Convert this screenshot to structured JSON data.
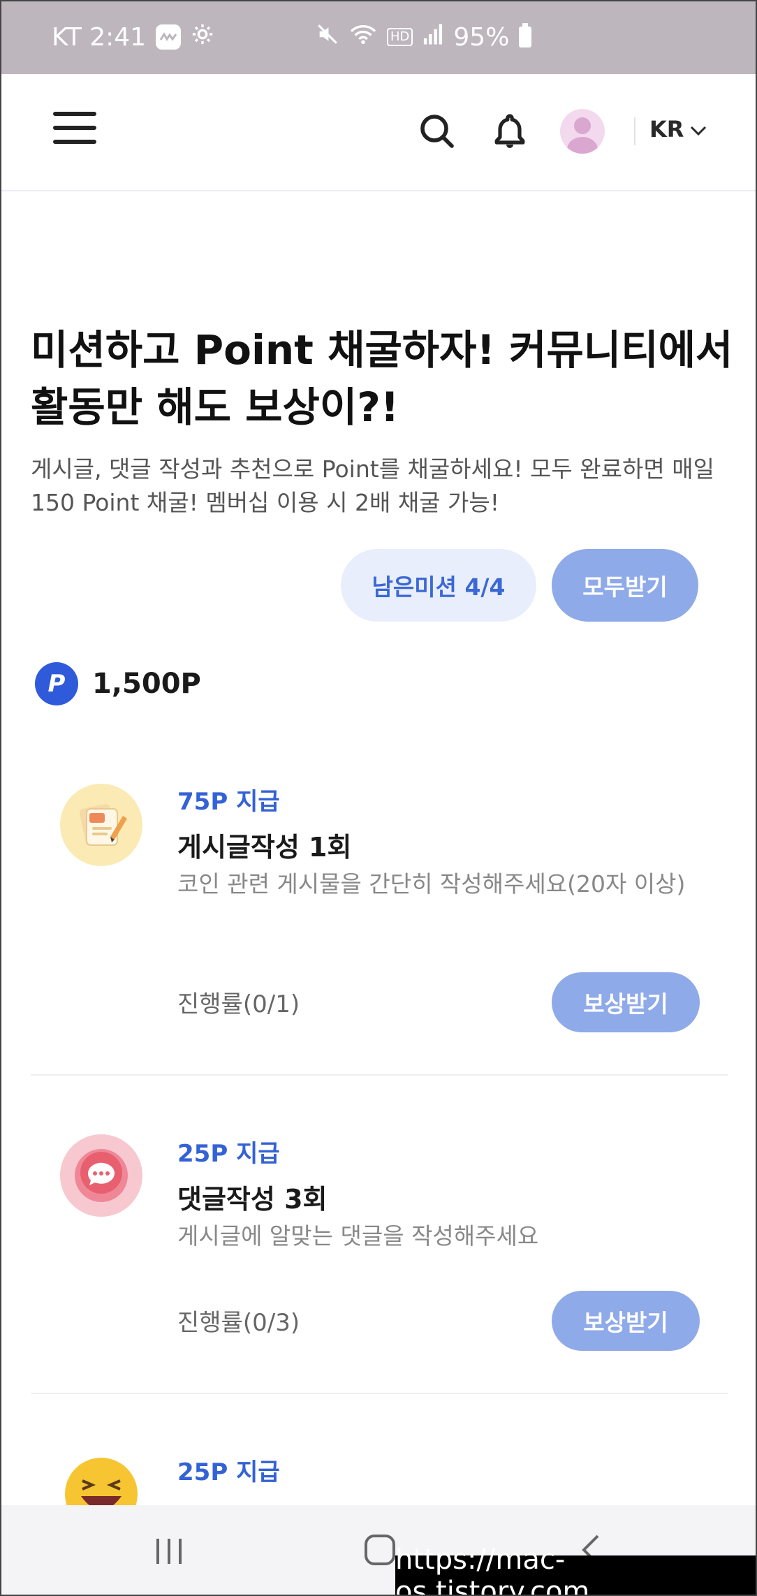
{
  "status_bar": {
    "carrier_time": "KT 2:41",
    "hd_label": "HD",
    "battery": "95%"
  },
  "header": {
    "language": "KR"
  },
  "hero": {
    "title": "미션하고 Point 채굴하자! 커뮤니티에서 활동만 해도 보상이?!",
    "description": "게시글, 댓글 작성과 추천으로 Point를 채굴하세요! 모두 완료하면 매일 150 Point 채굴! 멤버십 이용 시 2배 채굴 가능!",
    "remaining_label": "남은미션 4/4",
    "receive_all_label": "모두받기"
  },
  "balance": {
    "icon_letter": "P",
    "value": "1,500P"
  },
  "missions": [
    {
      "reward": "75P 지급",
      "title": "게시글작성 1회",
      "description": "코인 관련 게시물을 간단히 작성해주세요(20자 이상)",
      "progress": "진행률(0/1)",
      "button": "보상받기"
    },
    {
      "reward": "25P 지급",
      "title": "댓글작성 3회",
      "description": "게시글에 알맞는 댓글을 작성해주세요",
      "progress": "진행률(0/3)",
      "button": "보상받기"
    },
    {
      "reward": "25P 지급"
    }
  ],
  "watermark": "https://mac-os.tistory.com",
  "colors": {
    "accent": "#3462d6",
    "button_bg": "#8faae8",
    "pill_bg": "#e8eefb",
    "status_bar": "#bdb6bd"
  },
  "icons": {
    "mission_1": "document-pen-icon",
    "mission_2": "chat-bubble-icon",
    "mission_3": "laughing-emoji-icon"
  }
}
